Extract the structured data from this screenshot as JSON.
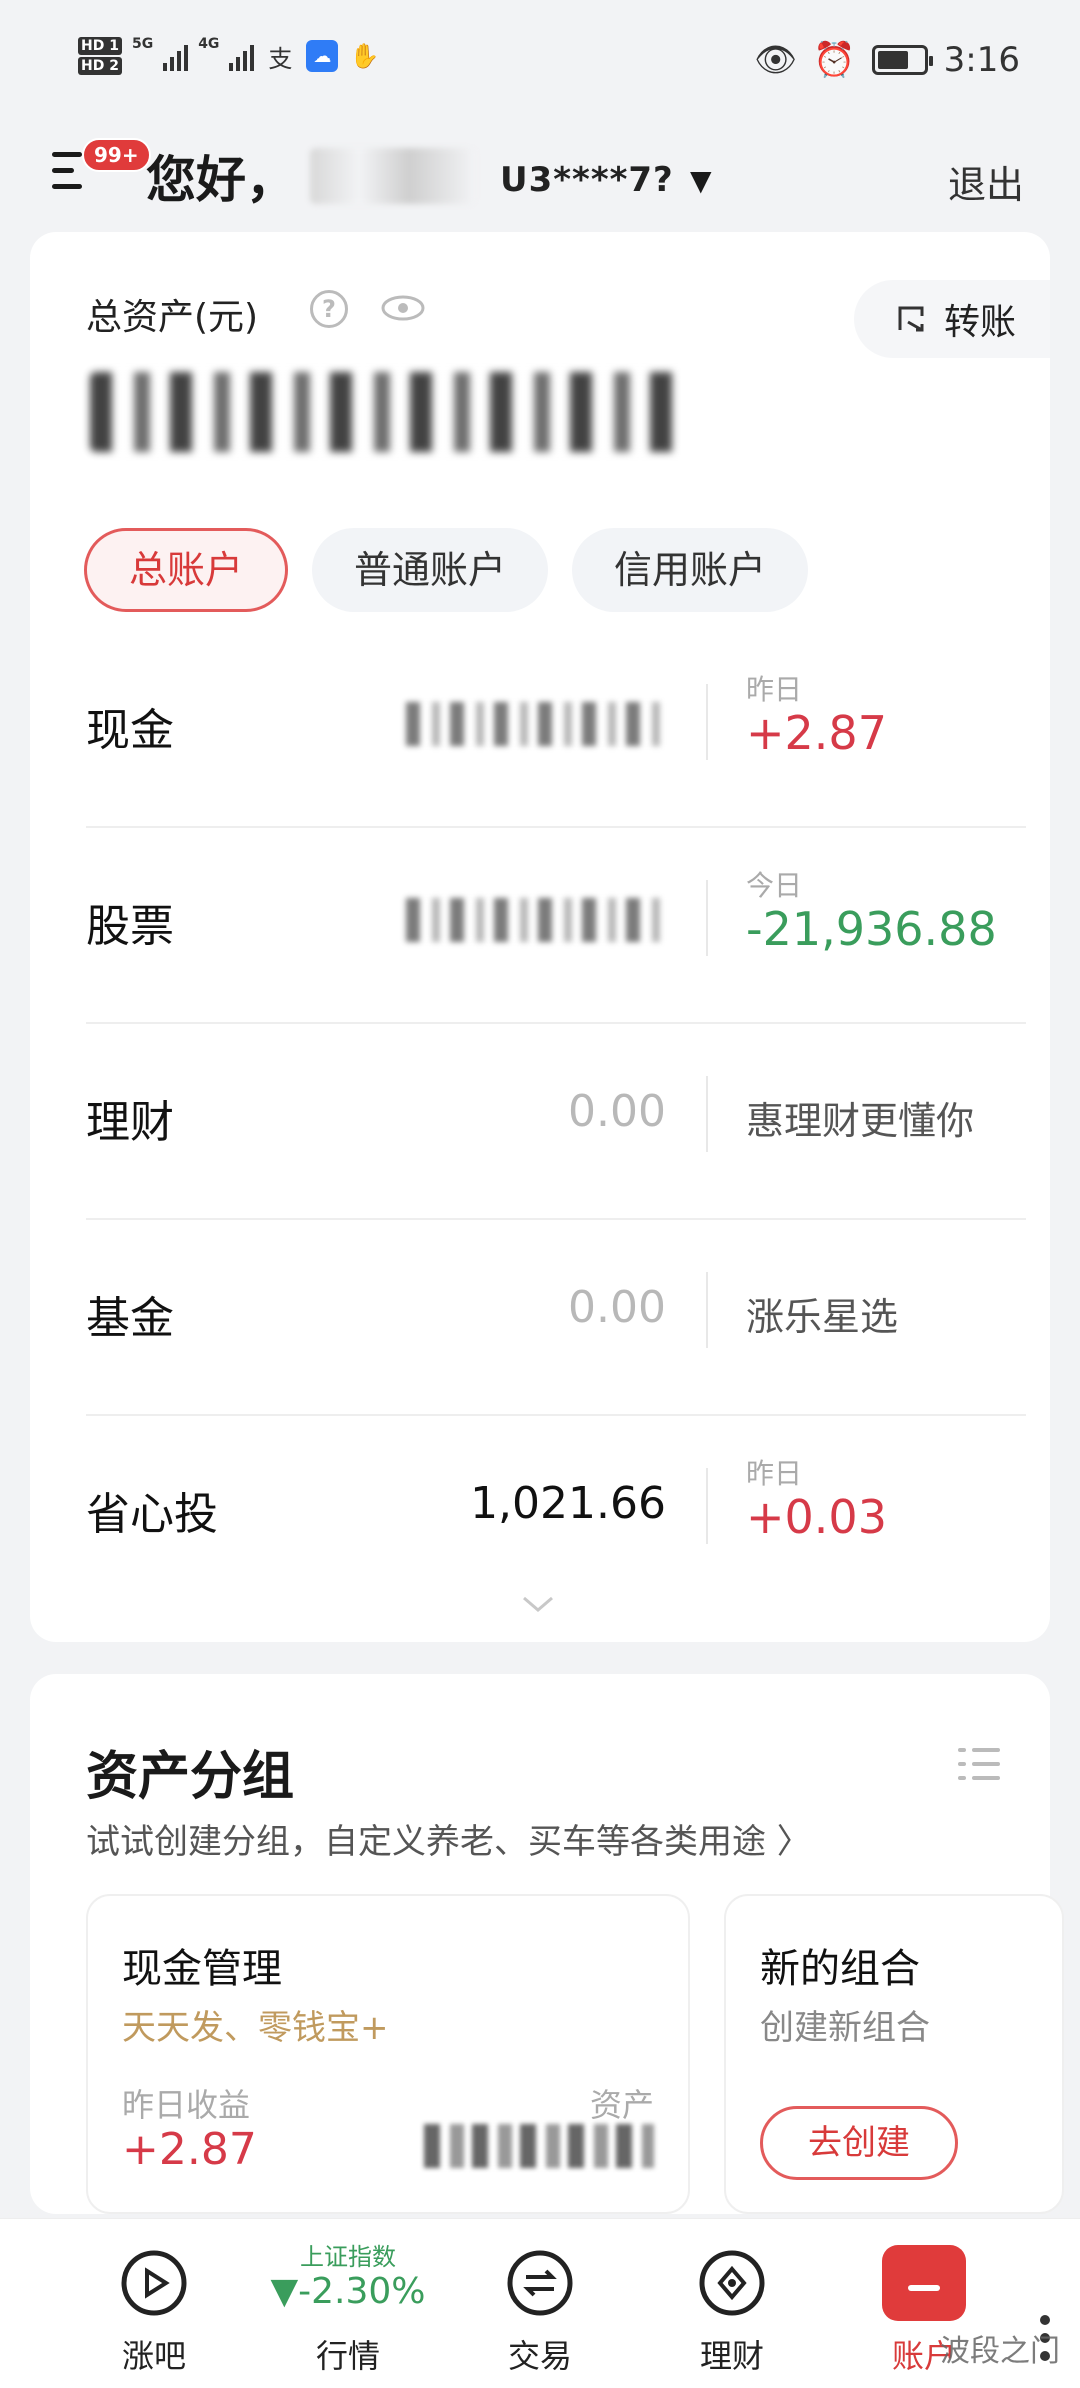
{
  "status_bar": {
    "hd1": "HD 1",
    "hd2": "HD 2",
    "net1": "5G",
    "net2": "4G",
    "app_icons": [
      "alipay-icon",
      "cloud-icon",
      "hand-icon"
    ],
    "right_icons": [
      "eye-comfort-icon",
      "alarm-icon",
      "battery-icon"
    ],
    "battery_level": 0.7,
    "time": "3:16"
  },
  "header": {
    "badge": "99+",
    "greeting": "您好，",
    "account_id": "U3****7?",
    "logout": "退出"
  },
  "assets": {
    "total_label": "总资产(元)",
    "help": "?",
    "transfer": "转账",
    "tabs": [
      "总账户",
      "普通账户",
      "信用账户"
    ],
    "rows": [
      {
        "label": "现金",
        "value": "",
        "masked": true,
        "sub": "昨日",
        "change": "+2.87",
        "dir": "up"
      },
      {
        "label": "股票",
        "value": "",
        "masked": true,
        "sub": "今日",
        "change": "-21,936.88",
        "dir": "down"
      },
      {
        "label": "理财",
        "value": "0.00",
        "masked": false,
        "promo": "惠理财更懂你"
      },
      {
        "label": "基金",
        "value": "0.00",
        "masked": false,
        "promo": "涨乐星选"
      },
      {
        "label": "省心投",
        "value": "1,021.66",
        "masked": false,
        "sub": "昨日",
        "change": "+0.03",
        "dir": "up"
      }
    ]
  },
  "groups": {
    "title": "资产分组",
    "subtitle": "试试创建分组，自定义养老、买车等各类用途 〉",
    "cash": {
      "title": "现金管理",
      "desc": "天天发、零钱宝+",
      "yield_label": "昨日收益",
      "yield_value": "+2.87",
      "asset_label": "资产"
    },
    "new": {
      "title": "新的组合",
      "desc": "创建新组合",
      "button": "去创建"
    }
  },
  "bottom_nav": {
    "items": [
      {
        "label": "涨吧",
        "icon": "play-circle-icon"
      },
      {
        "label": "行情",
        "index_name": "上证指数",
        "index_value": "▼-2.30%"
      },
      {
        "label": "交易",
        "icon": "exchange-icon"
      },
      {
        "label": "理财",
        "icon": "diamond-icon"
      },
      {
        "label": "账户",
        "icon": "account-icon"
      }
    ]
  },
  "watermark": "波段之门",
  "colors": {
    "red": "#d63a48",
    "green": "#3a9d5c",
    "accent": "#e03b3b"
  }
}
